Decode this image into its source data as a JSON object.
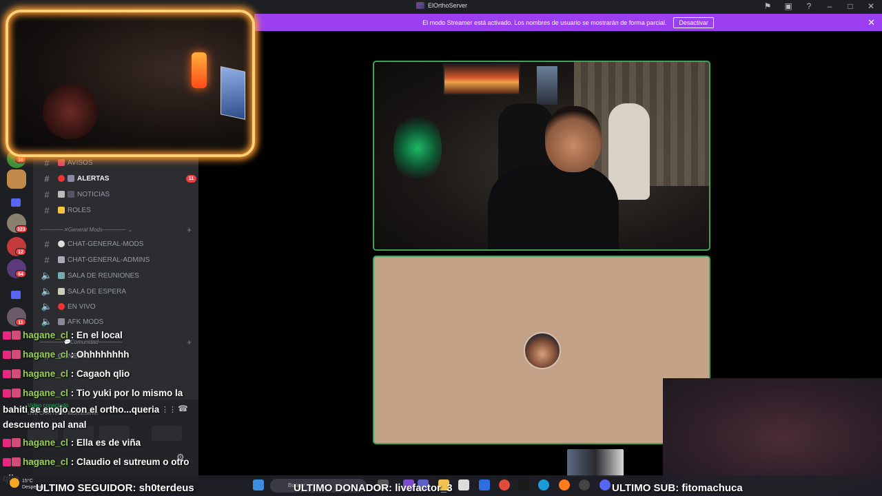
{
  "window": {
    "title": "ElOrthoServer"
  },
  "banner": {
    "text": "El modo Streamer está activado. Los nombres de usuario se mostrarán de forma parcial.",
    "button_label": "Desactivar"
  },
  "server_rail": {
    "badges": [
      "16",
      "323",
      "12",
      "64",
      "11"
    ]
  },
  "channels": [
    {
      "name": "AVISOS",
      "type": "text",
      "unread": false,
      "count": null
    },
    {
      "name": "ALERTAS",
      "type": "text",
      "unread": true,
      "count": "11"
    },
    {
      "name": "NOTICIAS",
      "type": "text",
      "unread": false,
      "count": null
    },
    {
      "name": "ROLES",
      "type": "text",
      "unread": false,
      "count": null
    }
  ],
  "categories": {
    "general_mods": "General Mods",
    "comunidad": "Comunidad"
  },
  "mod_channels": [
    {
      "name": "CHAT-GENERAL-MODS",
      "type": "text"
    },
    {
      "name": "CHAT-GENERAL-ADMINS",
      "type": "text"
    },
    {
      "name": "SALA DE REUNIONES",
      "type": "voice"
    },
    {
      "name": "SALA DE ESPERA",
      "type": "voice"
    },
    {
      "name": "EN VIVO",
      "type": "voice"
    },
    {
      "name": "AFK MODS",
      "type": "voice"
    }
  ],
  "community_channels": [
    {
      "name": "GENERAL",
      "type": "text"
    }
  ],
  "voice_panel": {
    "status": "Video conectado",
    "channel": "LIVE CHATTING / ElOrthoServer"
  },
  "user_panel": {
    "status": "Invisible"
  },
  "chat": [
    {
      "user": "hagane_cl",
      "text": "En el local"
    },
    {
      "user": "hagane_cl",
      "text": "Ohhhhhhhh"
    },
    {
      "user": "hagane_cl",
      "text": "Cagaoh qlio"
    },
    {
      "user": "hagane_cl",
      "text": "Tio yuki por lo mismo la bahiti se enojo con el ortho...queria descuento pal anal"
    },
    {
      "user": "hagane_cl",
      "text": "Ella es de viña"
    },
    {
      "user": "hagane_cl",
      "text": "Claudio el sutreum o otro qlio"
    }
  ],
  "taskbar": {
    "weather_temp": "15°C",
    "weather_desc": "Despejado",
    "search_placeholder": "Buscar"
  },
  "ticker": {
    "follower": "ULTIMO SEGUIDOR: sh0terdeus",
    "donor": "ULTIMO DONADOR: livefactor_3",
    "sub": "ULTIMO SUB: fitomachuca"
  },
  "colors": {
    "banner": "#9b3ff0",
    "speaking_border": "#3ba55c",
    "chat_user": "#9ad05a",
    "badge_red": "#f23f43"
  }
}
